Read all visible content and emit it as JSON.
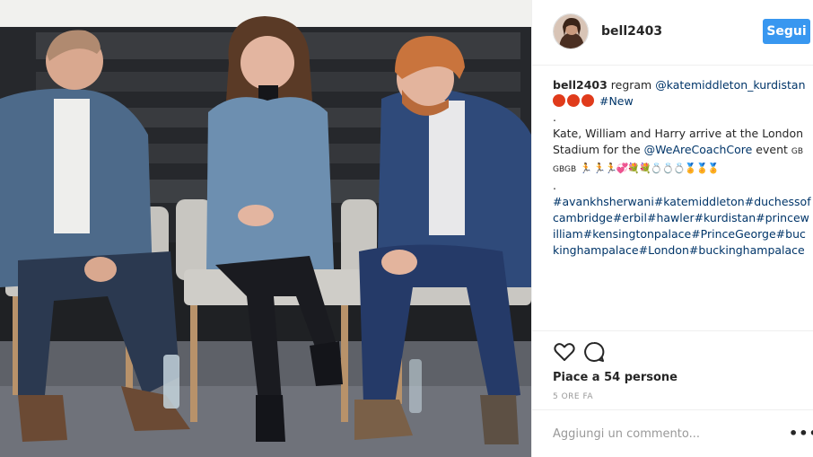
{
  "post": {
    "username": "bell2403",
    "follow_label": "Segui",
    "photo_alt": "Kate, William and Harry seated on a stage",
    "caption": {
      "username": "bell2403",
      "text_regram": " regram ",
      "mention_source": "@katemiddleton_kurdistan",
      "hashtag_new": "#New",
      "dot_line": ".",
      "body_text": "Kate, William and Harry arrive at the London Stadium for the ",
      "mention_event": "@WeAreCoachCore",
      "body_event": " event ",
      "flags_1": "GB",
      "flags_2": "GBGB",
      "emoji_line": "🏃 🏃🏃💞💐💐💍💍💍🏅🏅🏅",
      "dot_line_2": ".",
      "hashtags": "#avankhsherwani#katemiddleton#duchessofcambridge#erbil#hawler#kurdistan#princewilliam#kensingtonpalace#PrinceGeorge#buckinghampalace#London#buckinghampalace"
    },
    "likes_text": "Piace a 54 persone",
    "time_text": "5 ORE FA",
    "comment_placeholder": "Aggiungi un commento...",
    "more_label": "•••"
  },
  "icons": {
    "like": "heart-icon",
    "comment": "comment-bubble-icon",
    "options": "more-options-icon"
  },
  "colors": {
    "follow_button": "#3897f0",
    "link": "#003569",
    "red_circle": "#e03b1b"
  }
}
